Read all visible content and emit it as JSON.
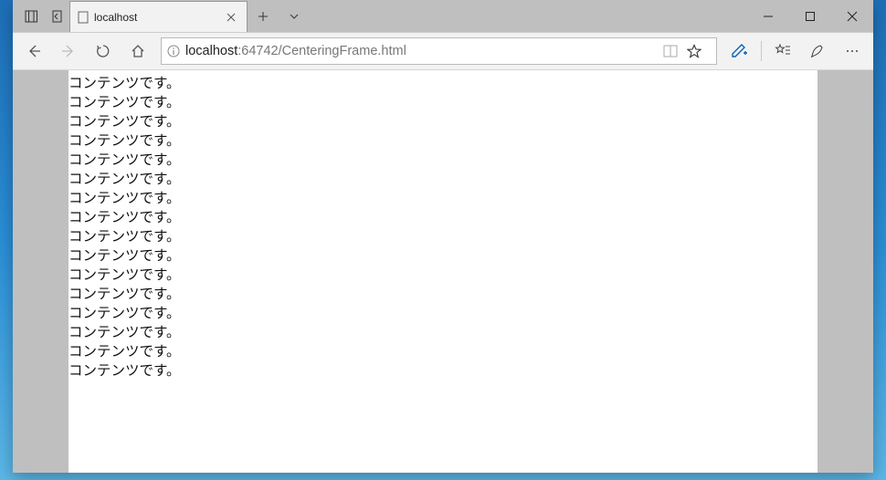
{
  "tab": {
    "title": "localhost"
  },
  "address": {
    "host": "localhost",
    "port": ":64742",
    "path": "/CenteringFrame.html"
  },
  "content": {
    "lines": [
      "コンテンツです。",
      "コンテンツです。",
      "コンテンツです。",
      "コンテンツです。",
      "コンテンツです。",
      "コンテンツです。",
      "コンテンツです。",
      "コンテンツです。",
      "コンテンツです。",
      "コンテンツです。",
      "コンテンツです。",
      "コンテンツです。",
      "コンテンツです。",
      "コンテンツです。",
      "コンテンツです。",
      "コンテンツです。"
    ]
  }
}
